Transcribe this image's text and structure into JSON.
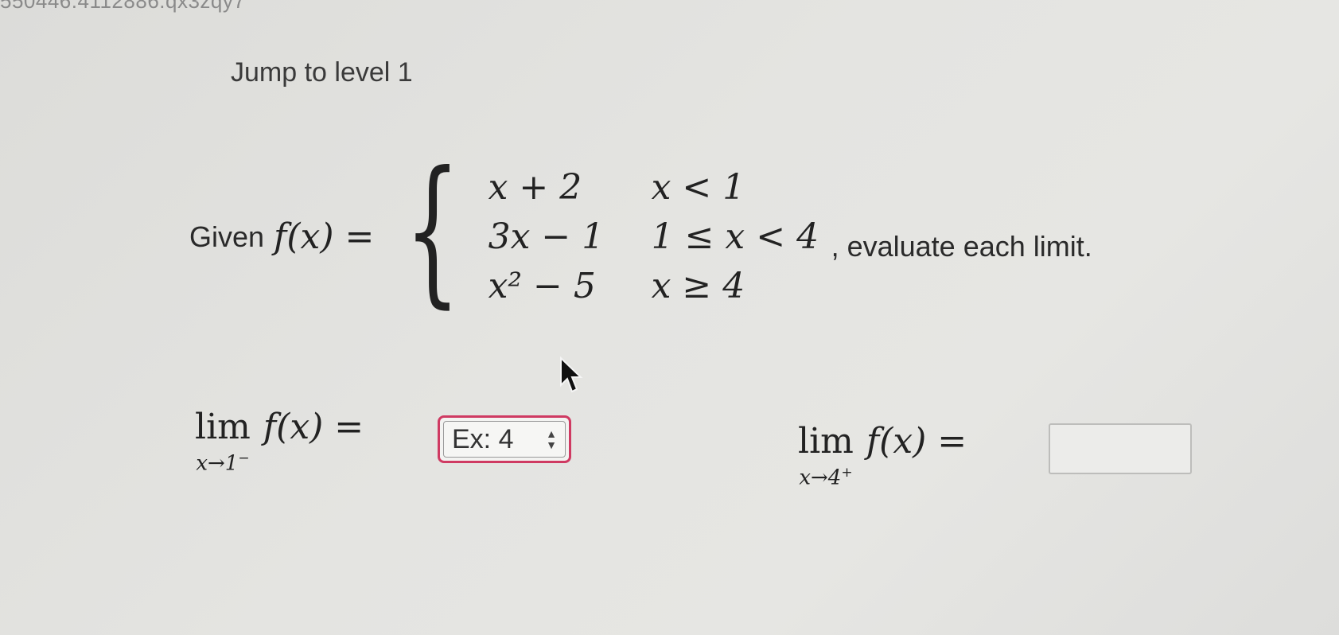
{
  "header": {
    "code": "550446.4112886.qx3zqy7"
  },
  "level": {
    "label": "Jump to level 1"
  },
  "problem": {
    "given": "Given",
    "function_lhs": "f(x) =",
    "cases": [
      {
        "expr": "x + 2",
        "cond": "x < 1"
      },
      {
        "expr": "3x − 1",
        "cond": "1 ≤ x < 4"
      },
      {
        "expr": "x² − 5",
        "cond": "x ≥ 4"
      }
    ],
    "instruction": ", evaluate each limit."
  },
  "limits": [
    {
      "lim": "lim",
      "sub_var": "x→1",
      "sub_side": "−",
      "expr": "f(x) =",
      "answer_placeholder": "Ex: 4"
    },
    {
      "lim": "lim",
      "sub_var": "x→4",
      "sub_side": "+",
      "expr": "f(x) =",
      "answer_value": ""
    }
  ],
  "colors": {
    "focus_border": "#cf3a62",
    "background": "#e3e3e0"
  }
}
